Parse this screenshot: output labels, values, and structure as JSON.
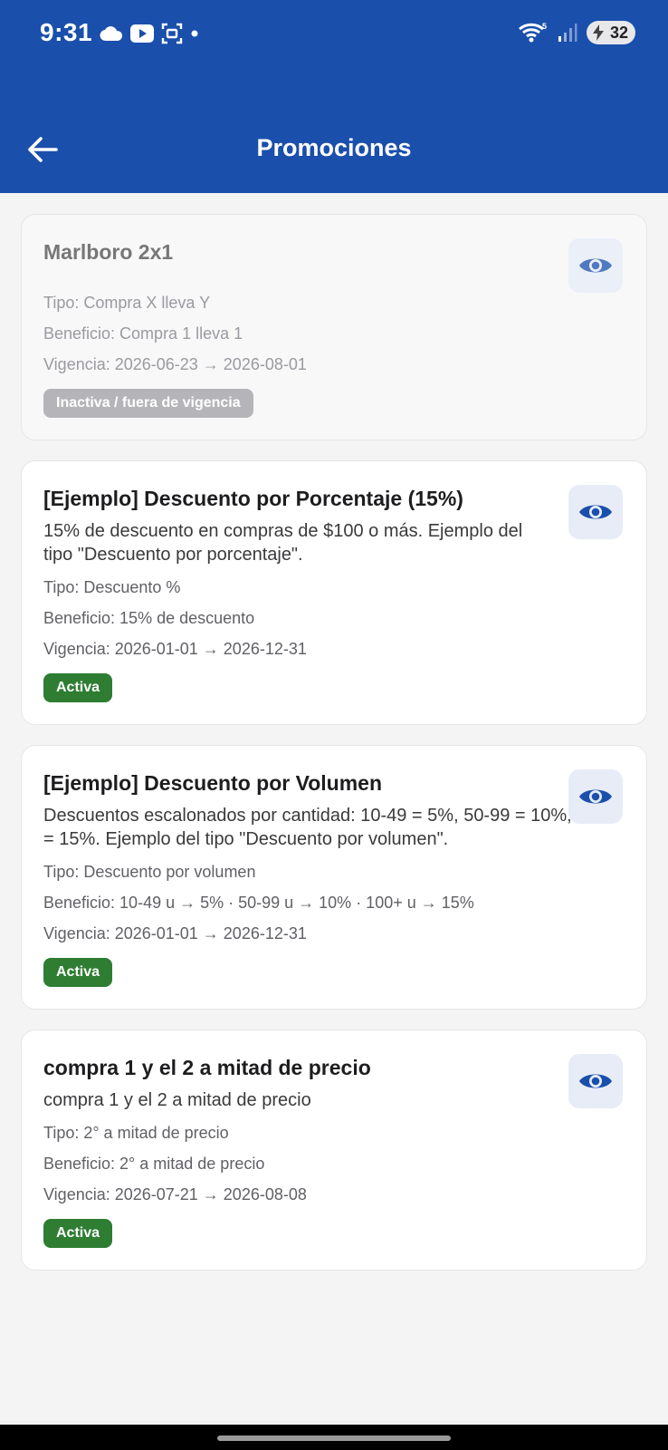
{
  "status": {
    "time": "9:31",
    "battery": "32",
    "icons_left": [
      "cloud-icon",
      "youtube-icon",
      "screenshot-icon",
      "dot-icon"
    ],
    "icons_right": [
      "wifi-icon",
      "signal-icon",
      "battery-icon"
    ]
  },
  "colors": {
    "primary": "#1a4fac",
    "active_badge": "#2e7d32",
    "inactive_badge": "#b5b5b9"
  },
  "app_bar": {
    "title": "Promociones",
    "back_icon": "arrow-left-icon"
  },
  "promotions": [
    {
      "title": "Marlboro 2x1",
      "description": "",
      "type": "Tipo: Compra X lleva Y",
      "benefit": "Beneficio: Compra 1 lleva 1",
      "validity": "Vigencia: 2026-06-23 → 2026-08-01",
      "status": "Inactiva / fuera de vigencia",
      "active": false
    },
    {
      "title": "[Ejemplo] Descuento por Porcentaje (15%)",
      "description": "15% de descuento en compras de $100 o más. Ejemplo del tipo \"Descuento por porcentaje\".",
      "type": "Tipo: Descuento %",
      "benefit": "Beneficio: 15% de descuento",
      "validity": "Vigencia: 2026-01-01 → 2026-12-31",
      "status": "Activa",
      "active": true
    },
    {
      "title": "[Ejemplo] Descuento por Volumen",
      "description": "Descuentos escalonados por cantidad: 10-49 = 5%, 50-99 = 10%, 100+ = 15%. Ejemplo del tipo \"Descuento por volumen\".",
      "type": "Tipo: Descuento por volumen",
      "benefit": "Beneficio: 10-49 u → 5% · 50-99 u → 10% · 100+ u → 15%",
      "validity": "Vigencia: 2026-01-01 → 2026-12-31",
      "status": "Activa",
      "active": true
    },
    {
      "title": "compra 1 y el 2 a mitad de precio",
      "description": "compra 1 y el 2 a mitad de precio",
      "type": "Tipo: 2° a mitad de precio",
      "benefit": "Beneficio: 2° a mitad de precio",
      "validity": "Vigencia: 2026-07-21 → 2026-08-08",
      "status": "Activa",
      "active": true
    }
  ]
}
